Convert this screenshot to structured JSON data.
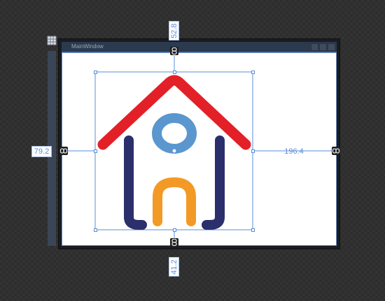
{
  "window": {
    "title": "MainWindow"
  },
  "margins": {
    "top": "52.8",
    "left": "79.2",
    "right": "196.4",
    "bottom": "41.2"
  },
  "icons": {
    "anchor": "chain-link-icon",
    "grid": "grid-icon",
    "logo": "house-logo-icon"
  },
  "colors": {
    "selection": "#5b8dd9",
    "roof": "#e32027",
    "walls": "#2b2f6b",
    "circle": "#5a97cf",
    "door": "#f29a25"
  }
}
